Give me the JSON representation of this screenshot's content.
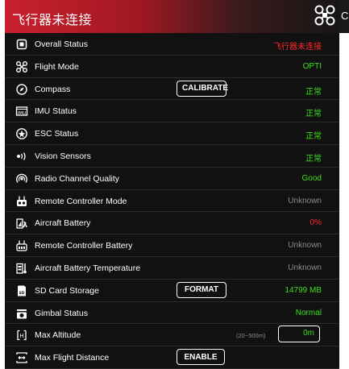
{
  "header": {
    "title": "飞行器未连接",
    "right_clip_text": "C"
  },
  "rows": [
    {
      "label": "Overall Status",
      "value": "飞行器未连接",
      "color": "#ff2a2a",
      "icon": "overall-status-icon"
    },
    {
      "label": "Flight Mode",
      "value": "OPTI",
      "color": "#3ee01a",
      "icon": "flight-mode-icon"
    },
    {
      "label": "Compass",
      "value": "正常",
      "color": "#3ee01a",
      "icon": "compass-icon",
      "button": "CALIBRATE"
    },
    {
      "label": "IMU Status",
      "value": "正常",
      "color": "#3ee01a",
      "icon": "imu-icon"
    },
    {
      "label": "ESC Status",
      "value": "正常",
      "color": "#3ee01a",
      "icon": "esc-icon"
    },
    {
      "label": "Vision Sensors",
      "value": "正常",
      "color": "#3ee01a",
      "icon": "vision-sensor-icon"
    },
    {
      "label": "Radio Channel Quality",
      "value": "Good",
      "color": "#3ee01a",
      "icon": "radio-signal-icon"
    },
    {
      "label": "Remote Controller Mode",
      "value": "Unknown",
      "color": "#8c8c8c",
      "icon": "rc-mode-icon"
    },
    {
      "label": "Aircraft Battery",
      "value": "0%",
      "color": "#ff2a2a",
      "icon": "aircraft-battery-icon"
    },
    {
      "label": "Remote Controller Battery",
      "value": "Unknown",
      "color": "#8c8c8c",
      "icon": "rc-battery-icon"
    },
    {
      "label": "Aircraft Battery Temperature",
      "value": "Unknown",
      "color": "#8c8c8c",
      "icon": "battery-temperature-icon"
    },
    {
      "label": "SD Card Storage",
      "value": "14799 MB",
      "color": "#3ee01a",
      "icon": "sd-card-icon",
      "button": "FORMAT"
    },
    {
      "label": "Gimbal Status",
      "value": "Normal",
      "color": "#3ee01a",
      "icon": "gimbal-icon"
    },
    {
      "label": "Max Altitude",
      "range": "(20~500m)",
      "input_value": "0m",
      "color": "#3ee01a",
      "icon": "max-altitude-icon"
    },
    {
      "label": "Max Flight Distance",
      "icon": "max-distance-icon",
      "button": "ENABLE"
    }
  ]
}
